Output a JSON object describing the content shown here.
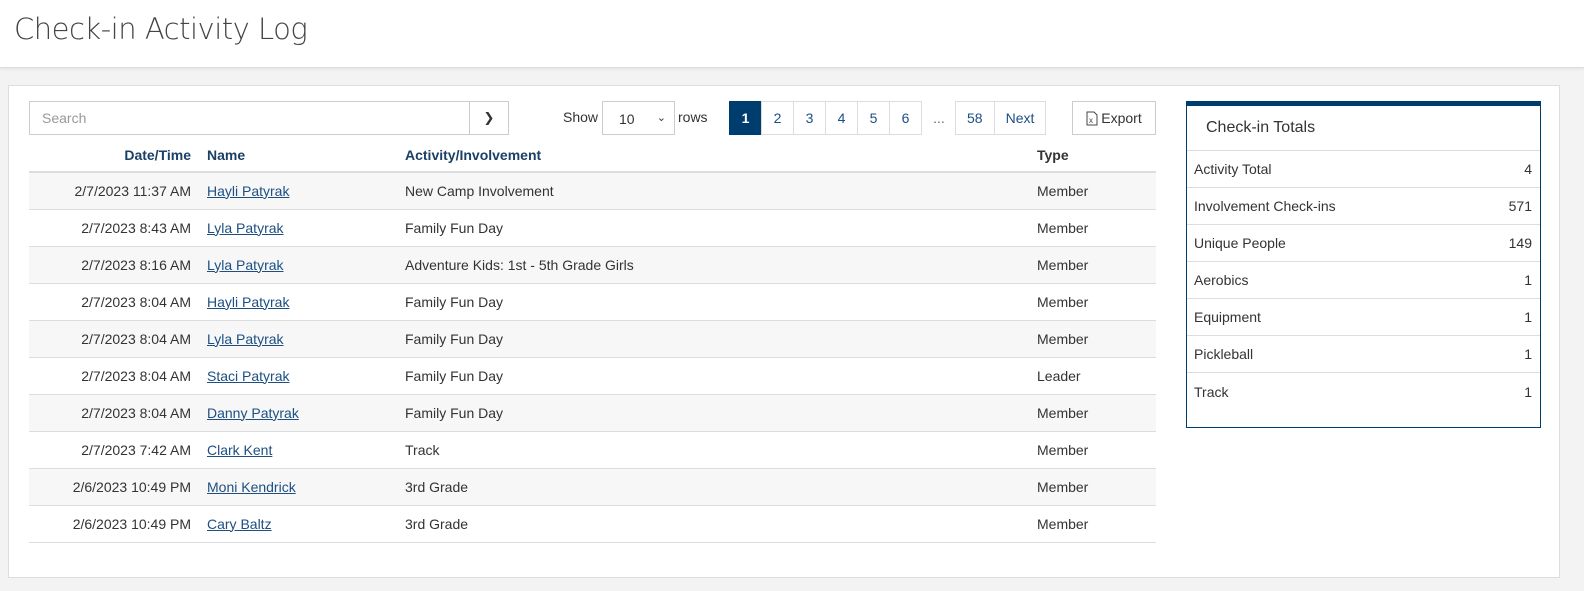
{
  "header": {
    "title": "Check-in Activity Log"
  },
  "toolbar": {
    "search_placeholder": "Search",
    "show_label": "Show",
    "rows_value": "10",
    "rows_label": "rows",
    "export_label": "Export"
  },
  "pagination": {
    "pages": [
      "1",
      "2",
      "3",
      "4",
      "5",
      "6"
    ],
    "ellipsis": "...",
    "last": "58",
    "next": "Next",
    "current": "1"
  },
  "table": {
    "headers": [
      "Date/Time",
      "Name",
      "Activity/Involvement",
      "Type"
    ],
    "rows": [
      [
        "2/7/2023 11:37 AM",
        "Hayli Patyrak",
        "New Camp Involvement",
        "Member"
      ],
      [
        "2/7/2023 8:43 AM",
        "Lyla Patyrak",
        "Family Fun Day",
        "Member"
      ],
      [
        "2/7/2023 8:16 AM",
        "Lyla Patyrak",
        "Adventure Kids: 1st - 5th Grade Girls",
        "Member"
      ],
      [
        "2/7/2023 8:04 AM",
        "Hayli Patyrak",
        "Family Fun Day",
        "Member"
      ],
      [
        "2/7/2023 8:04 AM",
        "Lyla Patyrak",
        "Family Fun Day",
        "Member"
      ],
      [
        "2/7/2023 8:04 AM",
        "Staci Patyrak",
        "Family Fun Day",
        "Leader"
      ],
      [
        "2/7/2023 8:04 AM",
        "Danny Patyrak",
        "Family Fun Day",
        "Member"
      ],
      [
        "2/7/2023 7:42 AM",
        "Clark Kent",
        "Track",
        "Member"
      ],
      [
        "2/6/2023 10:49 PM",
        "Moni Kendrick",
        "3rd Grade",
        "Member"
      ],
      [
        "2/6/2023 10:49 PM",
        "Cary Baltz",
        "3rd Grade",
        "Member"
      ]
    ]
  },
  "totals": {
    "title": "Check-in Totals",
    "items": [
      {
        "label": "Activity Total",
        "value": "4"
      },
      {
        "label": "Involvement Check-ins",
        "value": "571"
      },
      {
        "label": "Unique People",
        "value": "149"
      },
      {
        "label": "Aerobics",
        "value": "1"
      },
      {
        "label": "Equipment",
        "value": "1"
      },
      {
        "label": "Pickleball",
        "value": "1"
      },
      {
        "label": "Track",
        "value": "1"
      }
    ]
  },
  "colors": {
    "accent": "#003d6f",
    "link": "#1d4f82"
  }
}
